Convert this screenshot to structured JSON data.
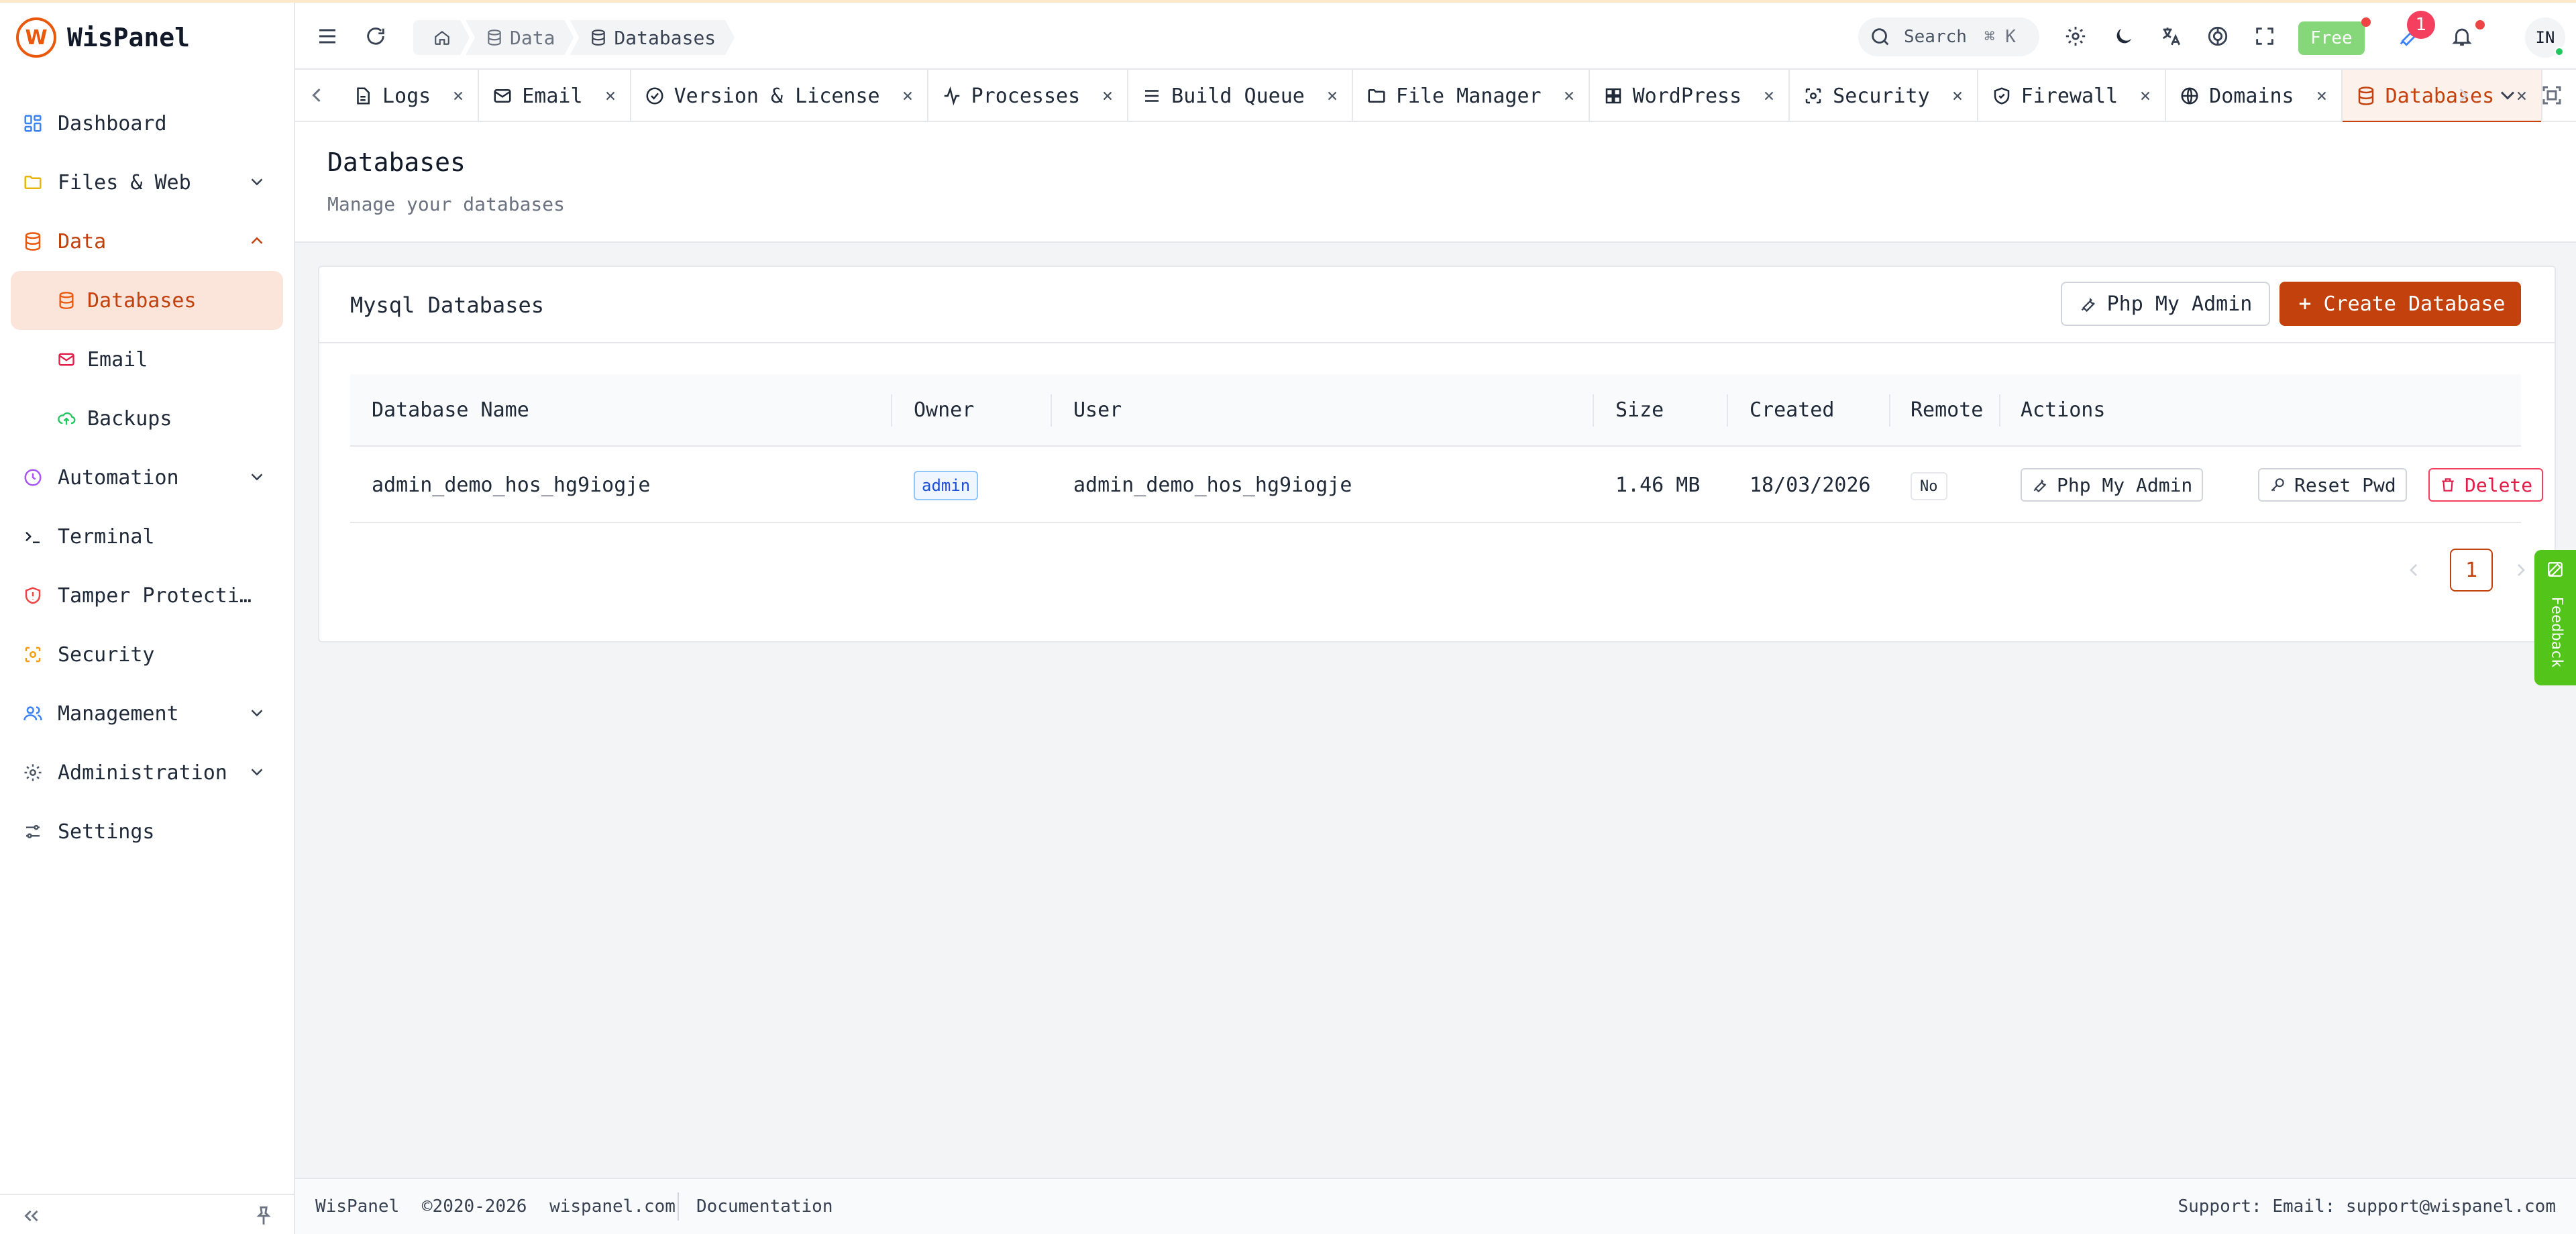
{
  "app": {
    "name": "WisPanel",
    "logo_letter": "W"
  },
  "sidebar": {
    "items": [
      {
        "label": "Dashboard",
        "icon": "dashboard-icon"
      },
      {
        "label": "Files & Web",
        "icon": "folder-icon",
        "expandable": true
      },
      {
        "label": "Data",
        "icon": "database-icon",
        "expandable": true,
        "expanded": true
      },
      {
        "label": "Databases",
        "icon": "database-icon",
        "sub": true,
        "selected": true
      },
      {
        "label": "Email",
        "icon": "mail-icon",
        "sub": true
      },
      {
        "label": "Backups",
        "icon": "cloud-upload-icon",
        "sub": true
      },
      {
        "label": "Automation",
        "icon": "clock-icon",
        "expandable": true
      },
      {
        "label": "Terminal",
        "icon": "terminal-icon"
      },
      {
        "label": "Tamper Protecti…",
        "icon": "shield-alert-icon"
      },
      {
        "label": "Security",
        "icon": "scan-icon"
      },
      {
        "label": "Management",
        "icon": "users-icon",
        "expandable": true
      },
      {
        "label": "Administration",
        "icon": "gear-icon",
        "expandable": true
      },
      {
        "label": "Settings",
        "icon": "sliders-icon"
      }
    ]
  },
  "header": {
    "breadcrumb": [
      "Data",
      "Databases"
    ],
    "search_label": "Search",
    "search_shortcut": "⌘ K",
    "plan_badge": "Free",
    "notification_count": "1",
    "avatar_initials": "IN"
  },
  "tabs": [
    {
      "label": "Logs",
      "icon": "file-icon"
    },
    {
      "label": "Email",
      "icon": "mail-icon"
    },
    {
      "label": "Version & License",
      "icon": "check-circle-icon"
    },
    {
      "label": "Processes",
      "icon": "activity-icon"
    },
    {
      "label": "Build Queue",
      "icon": "list-icon"
    },
    {
      "label": "File Manager",
      "icon": "folder-icon"
    },
    {
      "label": "WordPress",
      "icon": "grid-icon"
    },
    {
      "label": "Security",
      "icon": "scan-icon"
    },
    {
      "label": "Firewall",
      "icon": "shield-check-icon"
    },
    {
      "label": "Domains",
      "icon": "globe-icon"
    },
    {
      "label": "Databases",
      "icon": "database-icon",
      "active": true
    }
  ],
  "page": {
    "title": "Databases",
    "subtitle": "Manage your databases"
  },
  "card": {
    "title": "Mysql Databases",
    "phpmyadmin_label": "Php My Admin",
    "create_label": "Create Database",
    "columns": [
      "Database Name",
      "Owner",
      "User",
      "Size",
      "Created",
      "Remote",
      "Actions"
    ],
    "rows": [
      {
        "name": "admin_demo_hos_hg9iogje",
        "owner": "admin",
        "user": "admin_demo_hos_hg9iogje",
        "size": "1.46 MB",
        "created": "18/03/2026",
        "remote": "No",
        "actions": [
          "Php My Admin",
          "Reset Pwd",
          "Delete"
        ]
      }
    ],
    "current_page": "1"
  },
  "feedback_label": "Feedback",
  "footer": {
    "brand": "WisPanel",
    "copyright": "©2020-2026",
    "site": "wispanel.com",
    "docs": "Documentation",
    "support": "Support:  Email: support@wispanel.com"
  },
  "colors": {
    "accent": "#c2410c",
    "accent_bg": "#fbe4da",
    "success": "#52c41a",
    "danger": "#e11d48"
  }
}
